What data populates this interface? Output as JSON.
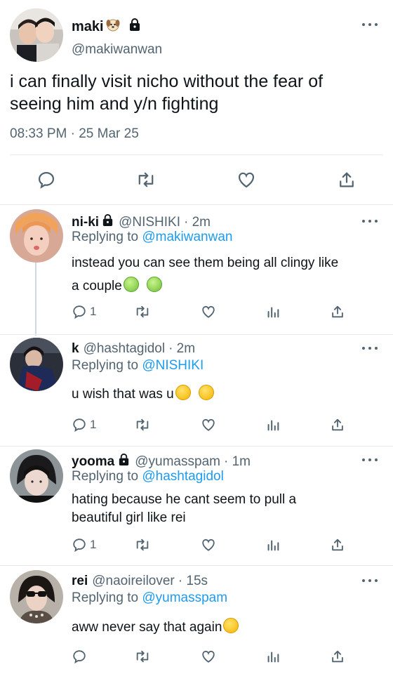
{
  "main_tweet": {
    "name": "maki",
    "handle": "@makiwanwan",
    "text_line1": "i can finally visit nicho without the fear of",
    "text_line2": "seeing him and y/n fighting",
    "timestamp": "08:33 PM · 25 Mar 25"
  },
  "replies": [
    {
      "name": "ni-ki",
      "handle": "@NISHIKI",
      "time": "· 2m",
      "replying_prefix": "Replying to",
      "replying_to": "@makiwanwan",
      "text_line1": "instead you can see them being all clingy like",
      "text_line2": "a couple",
      "reply_count": "1"
    },
    {
      "name": "k",
      "handle": "@hashtagidol",
      "time": "· 2m",
      "replying_prefix": "Replying to",
      "replying_to": "@NISHIKI",
      "text_line1": "u wish that was u",
      "reply_count": "1"
    },
    {
      "name": "yooma",
      "handle": "@yumasspam",
      "time": "· 1m",
      "replying_prefix": "Replying to",
      "replying_to": "@hashtagidol",
      "text_line1": "hating because he cant seem to pull a",
      "text_line2": "beautiful girl like rei",
      "reply_count": "1"
    },
    {
      "name": "rei",
      "handle": "@naoireilover",
      "time": "· 15s",
      "replying_prefix": "Replying to",
      "replying_to": "@yumasspam",
      "text_line1": "aww never say that again"
    }
  ],
  "colors": {
    "accent": "#1d9bf0",
    "muted": "#536471",
    "text": "#0f1419",
    "divider": "#e7e9ea"
  },
  "icons": [
    "dog-emoji-icon",
    "lock-icon",
    "more-icon",
    "reply-icon",
    "retweet-icon",
    "like-icon",
    "share-icon",
    "analytics-icon"
  ]
}
